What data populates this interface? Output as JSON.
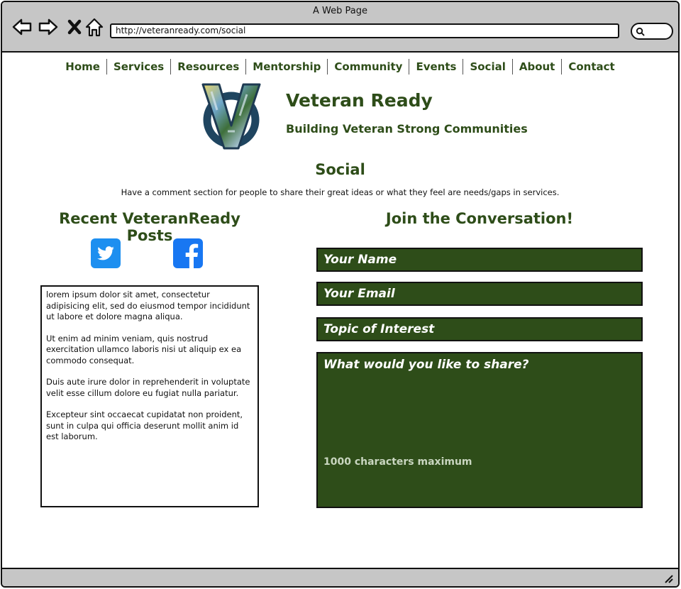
{
  "window": {
    "title": "A Web Page",
    "url": "http://veteranready.com/social"
  },
  "nav": {
    "items": [
      {
        "label": "Home"
      },
      {
        "label": "Services"
      },
      {
        "label": "Resources"
      },
      {
        "label": "Mentorship"
      },
      {
        "label": "Community"
      },
      {
        "label": "Events"
      },
      {
        "label": "Social"
      },
      {
        "label": "About"
      },
      {
        "label": "Contact"
      }
    ]
  },
  "brand": {
    "title": "Veteran Ready",
    "subtitle": "Building Veteran Strong Communities"
  },
  "page": {
    "title": "Social",
    "description": "Have a comment section for people to share their great ideas or what they feel are needs/gaps in services."
  },
  "left": {
    "heading": "Recent VeteranReady Posts",
    "icons": [
      "twitter-icon",
      "facebook-icon"
    ],
    "posts": [
      "lorem ipsum dolor sit amet, consectetur adipisicing elit, sed do eiusmod tempor incididunt ut labore et dolore magna aliqua.",
      "Ut enim ad minim veniam, quis nostrud exercitation ullamco laboris nisi ut aliquip ex ea commodo consequat.",
      "Duis aute irure dolor in reprehenderit in voluptate velit esse cillum dolore eu fugiat nulla pariatur.",
      "Excepteur sint occaecat cupidatat non proident, sunt in culpa qui officia deserunt mollit anim id est laborum."
    ]
  },
  "right": {
    "heading": "Join the Conversation!",
    "name_placeholder": "Your Name",
    "email_placeholder": "Your Email",
    "topic_placeholder": "Topic of Interest",
    "message_placeholder": "What would you like to share?",
    "message_hint": "1000 characters maximum"
  },
  "colors": {
    "brand_green": "#2e4d19",
    "twitter_blue": "#1d8ff0",
    "facebook_blue": "#1877f2",
    "chrome_gray": "#c6c6c6"
  }
}
